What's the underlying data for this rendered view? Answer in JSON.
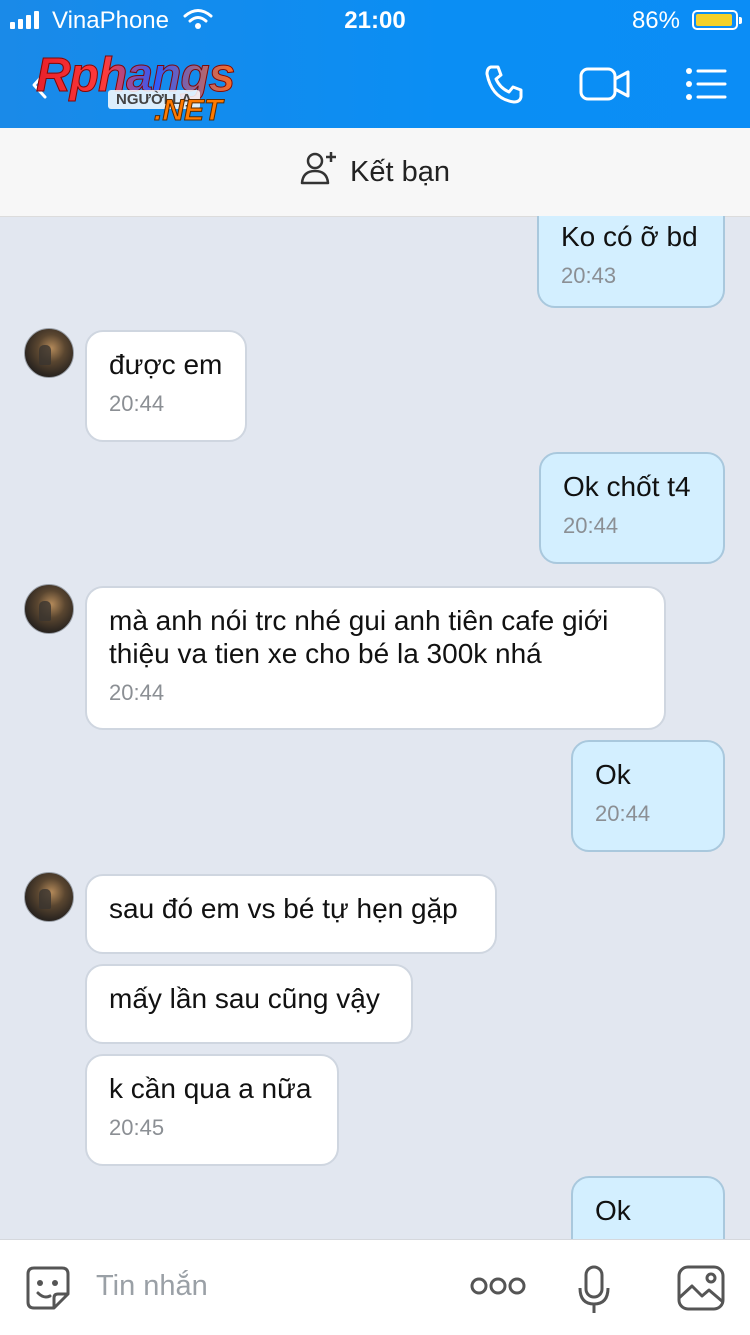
{
  "status_bar": {
    "carrier": "VinaPhone",
    "time": "21:00",
    "battery_percent": "86%",
    "battery_level": 0.86
  },
  "header": {
    "logo_brand": "Rphangs",
    "logo_sub": "NGƯỜI LẠ",
    "logo_net": ".NET",
    "icons": [
      "back-icon",
      "phone-icon",
      "video-call-icon",
      "menu-list-icon"
    ]
  },
  "add_friend": {
    "label": "Kết bạn",
    "icon": "add-user-icon"
  },
  "messages": [
    {
      "side": "out",
      "text": "Ko có ỡ bd",
      "time": "20:43"
    },
    {
      "side": "in",
      "text": "được em",
      "time": "20:44"
    },
    {
      "side": "out",
      "text": "Ok chốt t4",
      "time": "20:44"
    },
    {
      "side": "in",
      "text": "mà anh nói trc nhé gui anh tiên cafe giới thiệu va tien xe cho bé la 300k nhá",
      "time": "20:44"
    },
    {
      "side": "out",
      "text": "Ok",
      "time": "20:44"
    },
    {
      "side": "in",
      "text": "sau đó em vs bé tự hẹn gặp",
      "time": ""
    },
    {
      "side": "in",
      "text": "mấy lần sau cũng vậy",
      "time": ""
    },
    {
      "side": "in",
      "text": "k cần qua a nữa",
      "time": "20:45"
    },
    {
      "side": "out",
      "text": "Ok",
      "time": ""
    }
  ],
  "input_bar": {
    "placeholder": "Tin nhắn",
    "icons": [
      "sticker-icon",
      "more-icon",
      "microphone-icon",
      "image-icon"
    ]
  },
  "colors": {
    "header_blue": "#0a8ef4",
    "chat_background": "#e2e7f0",
    "outgoing_bubble": "#d3efff",
    "incoming_bubble": "#ffffff",
    "battery": "#f4d12a"
  }
}
